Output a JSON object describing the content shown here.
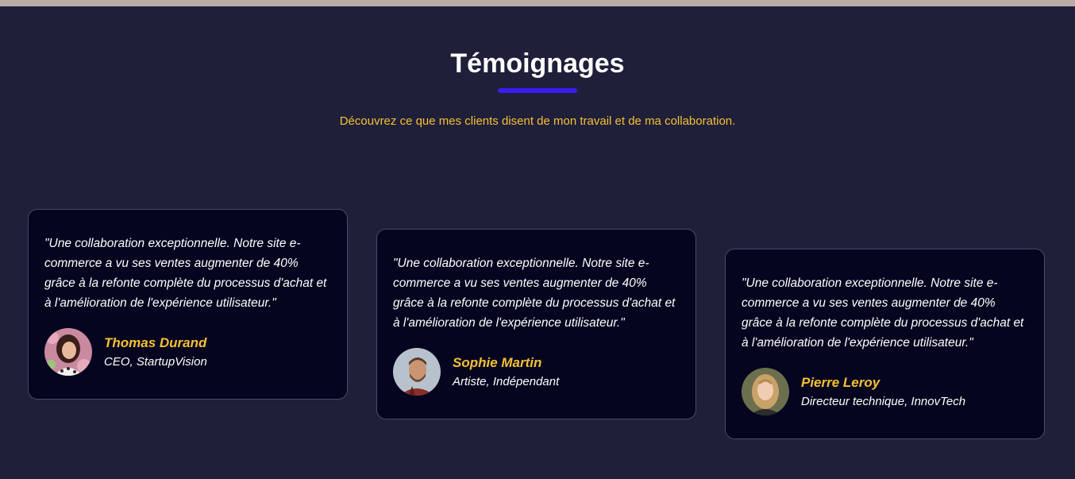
{
  "section": {
    "title": "Témoignages",
    "subtitle": "Découvrez ce que mes clients disent de mon travail et de ma collaboration."
  },
  "colors": {
    "background": "#1f1f3a",
    "card_background": "#05051f",
    "accent_underline": "#3a1df0",
    "name_color": "#f5c033",
    "top_bar": "#b9aba6"
  },
  "testimonials": [
    {
      "quote": "\"Une collaboration exceptionnelle. Notre site e-commerce a vu ses ventes augmenter de 40% grâce à la refonte complète du processus d'achat et à l'amélioration de l'expérience utilisateur.\"",
      "name": "Thomas Durand",
      "role": "CEO, StartupVision",
      "avatar": "avatar-photo-woman-floral"
    },
    {
      "quote": "\"Une collaboration exceptionnelle. Notre site e-commerce a vu ses ventes augmenter de 40% grâce à la refonte complète du processus d'achat et à l'amélioration de l'expérience utilisateur.\"",
      "name": "Sophie Martin",
      "role": "Artiste, Indépendant",
      "avatar": "avatar-photo-man-beard"
    },
    {
      "quote": "\"Une collaboration exceptionnelle. Notre site e-commerce a vu ses ventes augmenter de 40% grâce à la refonte complète du processus d'achat et à l'amélioration de l'expérience utilisateur.\"",
      "name": "Pierre Leroy",
      "role": "Directeur technique, InnovTech",
      "avatar": "avatar-photo-woman-blonde"
    }
  ]
}
